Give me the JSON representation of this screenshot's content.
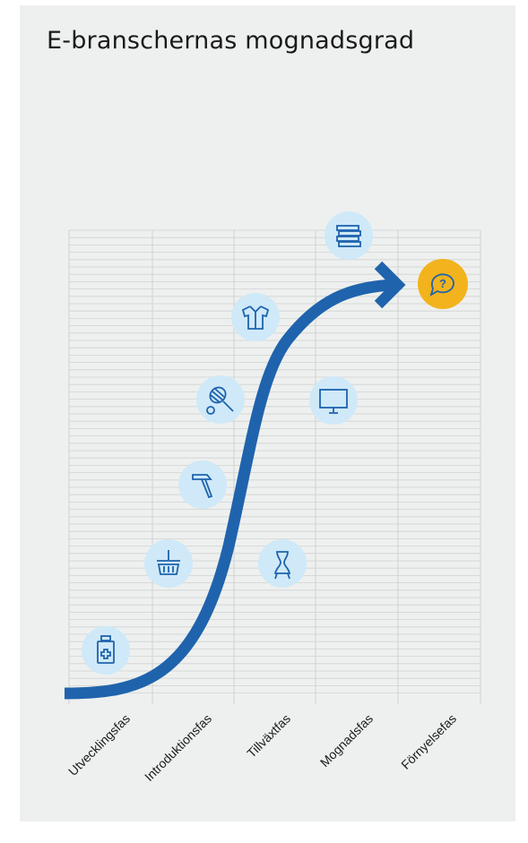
{
  "title": "E-branschernas mognadsgrad",
  "phases": [
    "Utvecklingsfas",
    "Introduktionsfas",
    "Tillväxtfas",
    "Mognadsfas",
    "Förnyelsefas"
  ],
  "icons": [
    {
      "id": "pharmacy-icon",
      "phase": "Utvecklingsfas"
    },
    {
      "id": "grocery-basket-icon",
      "phase": "Introduktionsfas"
    },
    {
      "id": "hammer-icon",
      "phase": "Introduktionsfas"
    },
    {
      "id": "tennis-racket-icon",
      "phase": "Tillväxtfas"
    },
    {
      "id": "shirt-icon",
      "phase": "Tillväxtfas"
    },
    {
      "id": "dress-form-icon",
      "phase": "Tillväxtfas"
    },
    {
      "id": "monitor-icon",
      "phase": "Mognadsfas"
    },
    {
      "id": "books-icon",
      "phase": "Mognadsfas"
    },
    {
      "id": "question-bubble-icon",
      "phase": "Förnyelsefas"
    }
  ],
  "colors": {
    "panel": "#eef0ef",
    "curve": "#1f63ad",
    "icon_circle": "#cfe9f8",
    "icon_stroke": "#1f63ad",
    "highlight_circle": "#f2b31c",
    "grid_line": "#cfd2d1",
    "label_text": "#1a1a1a"
  }
}
